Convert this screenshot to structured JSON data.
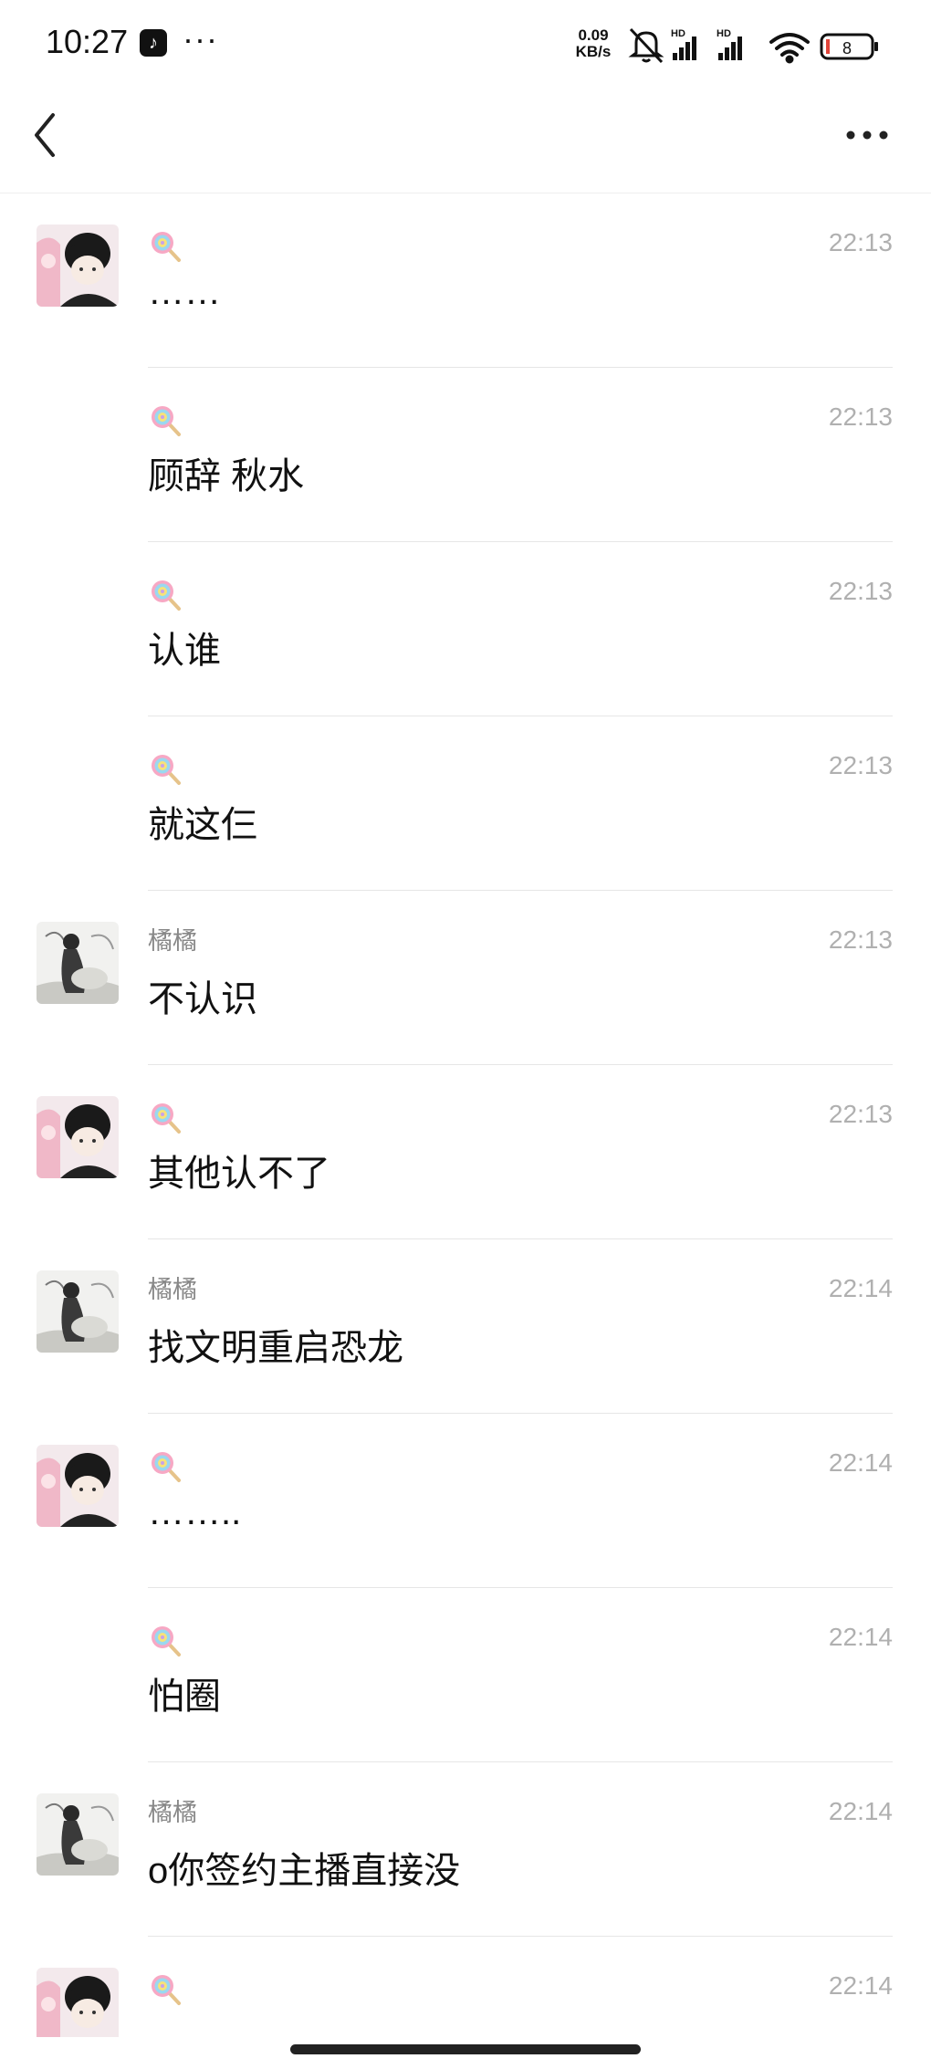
{
  "status_bar": {
    "time": "10:27",
    "app_icon": "tiktok-icon",
    "more": "···",
    "net_speed_value": "0.09",
    "net_speed_unit": "KB/s",
    "signal_label_1": "HD",
    "signal_label_2": "HD",
    "battery": "8"
  },
  "nav": {
    "back_icon": "back-chevron-icon",
    "more_icon": "more-icon"
  },
  "messages": [
    {
      "sender": "",
      "avatar": "avatar-lollipop-user",
      "time": "22:13",
      "text": "……"
    },
    {
      "sender": "",
      "avatar": "",
      "time": "22:13",
      "text": "顾辞 秋水"
    },
    {
      "sender": "",
      "avatar": "",
      "time": "22:13",
      "text": "认谁"
    },
    {
      "sender": "",
      "avatar": "",
      "time": "22:13",
      "text": "就这仨"
    },
    {
      "sender": "橘橘",
      "avatar": "avatar-juju",
      "time": "22:13",
      "text": "不认识"
    },
    {
      "sender": "",
      "avatar": "avatar-lollipop-user",
      "time": "22:13",
      "text": "其他认不了"
    },
    {
      "sender": "橘橘",
      "avatar": "avatar-juju",
      "time": "22:14",
      "text": "找文明重启恐龙"
    },
    {
      "sender": "",
      "avatar": "avatar-lollipop-user",
      "time": "22:14",
      "text": "…….."
    },
    {
      "sender": "",
      "avatar": "",
      "time": "22:14",
      "text": "怕圈"
    },
    {
      "sender": "橘橘",
      "avatar": "avatar-juju",
      "time": "22:14",
      "text": "o你签约主播直接没"
    },
    {
      "sender": "",
      "avatar": "avatar-lollipop-user",
      "time": "22:14",
      "text": ""
    }
  ],
  "colors": {
    "time_gray": "#b0b0b0",
    "sender_gray": "#888888",
    "divider": "#e6e6e6"
  }
}
